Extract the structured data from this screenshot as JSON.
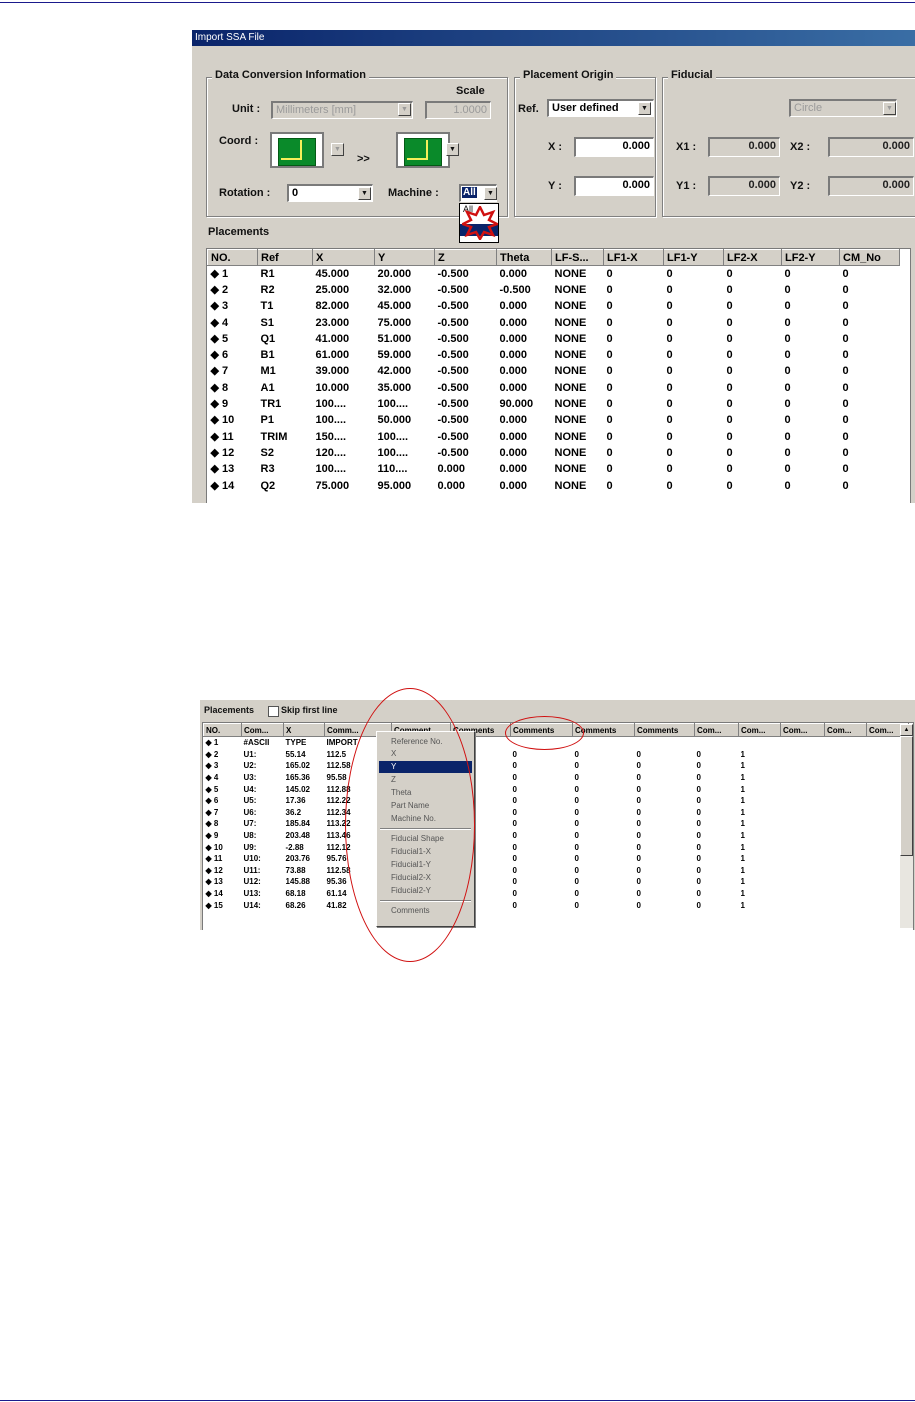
{
  "shot1": {
    "title": "Import SSA File",
    "data_conversion": {
      "group_title": "Data Conversion Information",
      "scale_label": "Scale",
      "unit_label": "Unit :",
      "unit_value": "Millimeters [mm]",
      "scale_value": "1.0000",
      "coord_label": "Coord :",
      "coord_arrow": ">>",
      "rotation_label": "Rotation :",
      "rotation_value": "0",
      "machine_label": "Machine :",
      "machine_value": "All",
      "machine_option": "All"
    },
    "placement_origin": {
      "group_title": "Placement Origin",
      "ref_label": "Ref.",
      "ref_value": "User defined",
      "x_label": "X :",
      "x_value": "0.000",
      "y_label": "Y :",
      "y_value": "0.000"
    },
    "fiducial": {
      "group_title": "Fiducial",
      "shape_value": "Circle",
      "x1_label": "X1 :",
      "x1_value": "0.000",
      "x2_label": "X2 :",
      "x2_value": "0.000",
      "y1_label": "Y1 :",
      "y1_value": "0.000",
      "y2_label": "Y2 :",
      "y2_value": "0.000"
    },
    "placements_label": "Placements",
    "columns": [
      "NO.",
      "Ref",
      "X",
      "Y",
      "Z",
      "Theta",
      "LF-S...",
      "LF1-X",
      "LF1-Y",
      "LF2-X",
      "LF2-Y",
      "CM_No"
    ],
    "rows": [
      [
        "◆ 1",
        "R1",
        "45.000",
        "20.000",
        "-0.500",
        "0.000",
        "NONE",
        "0",
        "0",
        "0",
        "0",
        "0"
      ],
      [
        "◆ 2",
        "R2",
        "25.000",
        "32.000",
        "-0.500",
        "-0.500",
        "NONE",
        "0",
        "0",
        "0",
        "0",
        "0"
      ],
      [
        "◆ 3",
        "T1",
        "82.000",
        "45.000",
        "-0.500",
        "0.000",
        "NONE",
        "0",
        "0",
        "0",
        "0",
        "0"
      ],
      [
        "◆ 4",
        "S1",
        "23.000",
        "75.000",
        "-0.500",
        "0.000",
        "NONE",
        "0",
        "0",
        "0",
        "0",
        "0"
      ],
      [
        "◆ 5",
        "Q1",
        "41.000",
        "51.000",
        "-0.500",
        "0.000",
        "NONE",
        "0",
        "0",
        "0",
        "0",
        "0"
      ],
      [
        "◆ 6",
        "B1",
        "61.000",
        "59.000",
        "-0.500",
        "0.000",
        "NONE",
        "0",
        "0",
        "0",
        "0",
        "0"
      ],
      [
        "◆ 7",
        "M1",
        "39.000",
        "42.000",
        "-0.500",
        "0.000",
        "NONE",
        "0",
        "0",
        "0",
        "0",
        "0"
      ],
      [
        "◆ 8",
        "A1",
        "10.000",
        "35.000",
        "-0.500",
        "0.000",
        "NONE",
        "0",
        "0",
        "0",
        "0",
        "0"
      ],
      [
        "◆ 9",
        "TR1",
        "100....",
        "100....",
        "-0.500",
        "90.000",
        "NONE",
        "0",
        "0",
        "0",
        "0",
        "0"
      ],
      [
        "◆ 10",
        "P1",
        "100....",
        "50.000",
        "-0.500",
        "0.000",
        "NONE",
        "0",
        "0",
        "0",
        "0",
        "0"
      ],
      [
        "◆ 11",
        "TRIM",
        "150....",
        "100....",
        "-0.500",
        "0.000",
        "NONE",
        "0",
        "0",
        "0",
        "0",
        "0"
      ],
      [
        "◆ 12",
        "S2",
        "120....",
        "100....",
        "-0.500",
        "0.000",
        "NONE",
        "0",
        "0",
        "0",
        "0",
        "0"
      ],
      [
        "◆ 13",
        "R3",
        "100....",
        "110....",
        "0.000",
        "0.000",
        "NONE",
        "0",
        "0",
        "0",
        "0",
        "0"
      ],
      [
        "◆ 14",
        "Q2",
        "75.000",
        "95.000",
        "0.000",
        "0.000",
        "NONE",
        "0",
        "0",
        "0",
        "0",
        "0"
      ]
    ]
  },
  "shot2": {
    "placements_label": "Placements",
    "skip_first_line_label": "Skip first line",
    "columns": [
      "NO.",
      "Com...",
      "X",
      "Comm...",
      "Comment",
      "Comments",
      "Comments",
      "Comments",
      "Comments",
      "Com...",
      "Com...",
      "Com...",
      "Com...",
      "Com..."
    ],
    "rows": [
      [
        "◆ 1",
        "#ASCII",
        "TYPE",
        "IMPORT",
        "",
        "",
        "",
        "",
        "",
        "",
        "",
        "",
        "",
        ""
      ],
      [
        "◆ 2",
        "U1:",
        "55.14",
        "112.5",
        "",
        "0",
        "0",
        "0",
        "0",
        "0",
        "1",
        "",
        "",
        ""
      ],
      [
        "◆ 3",
        "U2:",
        "165.02",
        "112.58",
        "",
        "0",
        "0",
        "0",
        "0",
        "0",
        "1",
        "",
        "",
        ""
      ],
      [
        "◆ 4",
        "U3:",
        "165.36",
        "95.58",
        "",
        "0",
        "0",
        "0",
        "0",
        "0",
        "1",
        "",
        "",
        ""
      ],
      [
        "◆ 5",
        "U4:",
        "145.02",
        "112.88",
        "",
        "0",
        "0",
        "0",
        "0",
        "0",
        "1",
        "",
        "",
        ""
      ],
      [
        "◆ 6",
        "U5:",
        "17.36",
        "112.22",
        "",
        "0",
        "0",
        "0",
        "0",
        "0",
        "1",
        "",
        "",
        ""
      ],
      [
        "◆ 7",
        "U6:",
        "36.2",
        "112.34",
        "",
        "0",
        "0",
        "0",
        "0",
        "0",
        "1",
        "",
        "",
        ""
      ],
      [
        "◆ 8",
        "U7:",
        "185.84",
        "113.22",
        "",
        "0",
        "0",
        "0",
        "0",
        "0",
        "1",
        "",
        "",
        ""
      ],
      [
        "◆ 9",
        "U8:",
        "203.48",
        "113.46",
        "",
        "0",
        "0",
        "0",
        "0",
        "0",
        "1",
        "",
        "",
        ""
      ],
      [
        "◆ 10",
        "U9:",
        "-2.88",
        "112.12",
        "",
        "0",
        "0",
        "0",
        "0",
        "0",
        "1",
        "",
        "",
        ""
      ],
      [
        "◆ 11",
        "U10:",
        "203.76",
        "95.76",
        "",
        "0",
        "0",
        "0",
        "0",
        "0",
        "1",
        "",
        "",
        ""
      ],
      [
        "◆ 12",
        "U11:",
        "73.88",
        "112.58",
        "",
        "0",
        "0",
        "0",
        "0",
        "0",
        "1",
        "",
        "",
        ""
      ],
      [
        "◆ 13",
        "U12:",
        "145.88",
        "95.36",
        "",
        "0",
        "0",
        "0",
        "0",
        "0",
        "1",
        "",
        "",
        ""
      ],
      [
        "◆ 14",
        "U13:",
        "68.18",
        "61.14",
        "",
        "0",
        "0",
        "0",
        "0",
        "0",
        "1",
        "",
        "",
        ""
      ],
      [
        "◆ 15",
        "U14:",
        "68.26",
        "41.82",
        "",
        "0",
        "0",
        "0",
        "0",
        "0",
        "1",
        "",
        "",
        ""
      ]
    ],
    "popup_items": [
      "Reference No.",
      "X",
      "Y",
      "Z",
      "Theta",
      "Part Name",
      "Machine No.",
      "Fiducial Shape",
      "Fiducial1-X",
      "Fiducial1-Y",
      "Fiducial2-X",
      "Fiducial2-Y",
      "Comments"
    ],
    "popup_selected": "Y"
  },
  "colors": {
    "annotation_red": "#d01010",
    "selection_blue": "#0a246a",
    "dialog_gray": "#d4d0c8",
    "coord_green": "#0a8a2a"
  }
}
